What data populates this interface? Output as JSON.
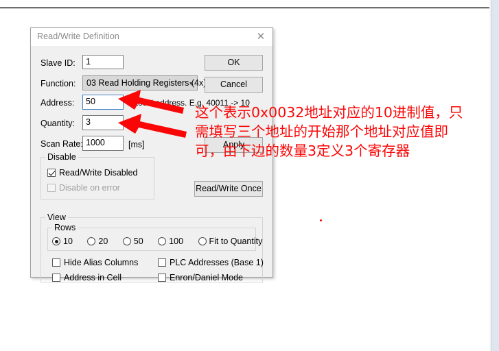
{
  "dialog": {
    "title": "Read/Write Definition",
    "close_icon": "close-icon",
    "fields": {
      "slave_id_label": "Slave ID:",
      "slave_id_value": "1",
      "function_label": "Function:",
      "function_value": "03 Read Holding Registers (4x)",
      "function_chevron": "∨",
      "address_label": "Address:",
      "address_value": "50",
      "address_hint": "rotocol address. E.g. 40011 -> 10",
      "quantity_label": "Quantity:",
      "quantity_value": "3",
      "scan_rate_label": "Scan Rate:",
      "scan_rate_value": "1000",
      "scan_rate_unit": "[ms]"
    },
    "buttons": {
      "ok": "OK",
      "cancel": "Cancel",
      "apply": "Apply",
      "read_write_once": "Read/Write Once"
    },
    "disable_group": {
      "title": "Disable",
      "read_write_disabled": "Read/Write Disabled",
      "read_write_disabled_checked": true,
      "disable_on_error": "Disable on error",
      "disable_on_error_checked": false
    },
    "view_group": {
      "title": "View",
      "rows_title": "Rows",
      "rows_options": [
        "10",
        "20",
        "50",
        "100",
        "Fit to Quantity"
      ],
      "rows_selected": "10",
      "checkboxes": [
        {
          "label": "Hide Alias Columns",
          "checked": false
        },
        {
          "label": "PLC Addresses (Base 1)",
          "checked": false
        },
        {
          "label": "Address in Cell",
          "checked": false
        },
        {
          "label": "Enron/Daniel Mode",
          "checked": false
        }
      ]
    }
  },
  "annotation": {
    "color": "#fb0606",
    "line1": "这个表示0x0032地址对应的10进制值，只",
    "line2": "需填写三个地址的开始那个地址对应值即",
    "line3": "可，由下边的数量3定义3个寄存器",
    "arrow1_name": "arrow-to-address-field",
    "arrow2_name": "arrow-to-quantity-field"
  }
}
